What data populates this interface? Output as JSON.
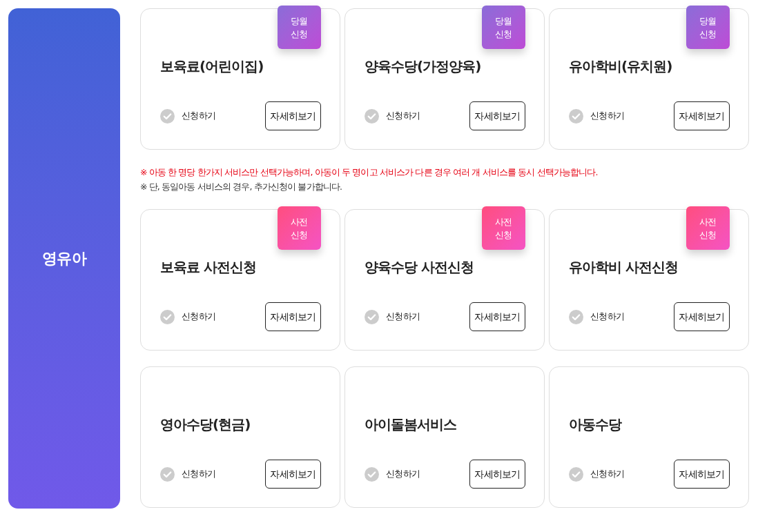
{
  "category": {
    "label": "영유아"
  },
  "card_rows": [
    {
      "cards": [
        {
          "title": "보육료(어린이집)",
          "badge": {
            "kind": "monthly",
            "lines": [
              "당월",
              "신청"
            ]
          },
          "apply": {
            "label": "신청하기",
            "checked": false
          },
          "details_button": "자세히보기"
        },
        {
          "title": "양육수당(가정양육)",
          "badge": {
            "kind": "monthly",
            "lines": [
              "당월",
              "신청"
            ]
          },
          "apply": {
            "label": "신청하기",
            "checked": false
          },
          "details_button": "자세히보기"
        },
        {
          "title": "유아학비(유치원)",
          "badge": {
            "kind": "monthly",
            "lines": [
              "당월",
              "신청"
            ]
          },
          "apply": {
            "label": "신청하기",
            "checked": false
          },
          "details_button": "자세히보기"
        }
      ],
      "notes": [
        {
          "kind": "alert",
          "text": "※ 아동 한 명당 한가지 서비스만 선택가능하며, 아동이 두 명이고 서비스가 다른 경우 여러 개 서비스를 동시 선택가능합니다."
        },
        {
          "kind": "plain",
          "text": "※ 단, 동일아동 서비스의 경우, 추가신청이 불가합니다."
        }
      ]
    },
    {
      "cards": [
        {
          "title": "보육료 사전신청",
          "badge": {
            "kind": "advance",
            "lines": [
              "사전",
              "신청"
            ]
          },
          "apply": {
            "label": "신청하기",
            "checked": false
          },
          "details_button": "자세히보기"
        },
        {
          "title": "양육수당 사전신청",
          "badge": {
            "kind": "advance",
            "lines": [
              "사전",
              "신청"
            ]
          },
          "apply": {
            "label": "신청하기",
            "checked": false
          },
          "details_button": "자세히보기"
        },
        {
          "title": "유아학비 사전신청",
          "badge": {
            "kind": "advance",
            "lines": [
              "사전",
              "신청"
            ]
          },
          "apply": {
            "label": "신청하기",
            "checked": false
          },
          "details_button": "자세히보기"
        }
      ]
    },
    {
      "cards": [
        {
          "title": "영아수당(현금)",
          "apply": {
            "label": "신청하기",
            "checked": false
          },
          "details_button": "자세히보기"
        },
        {
          "title": "아이돌봄서비스",
          "apply": {
            "label": "신청하기",
            "checked": false
          },
          "details_button": "자세히보기"
        },
        {
          "title": "아동수당",
          "apply": {
            "label": "신청하기",
            "checked": false
          },
          "details_button": "자세히보기"
        }
      ]
    }
  ]
}
